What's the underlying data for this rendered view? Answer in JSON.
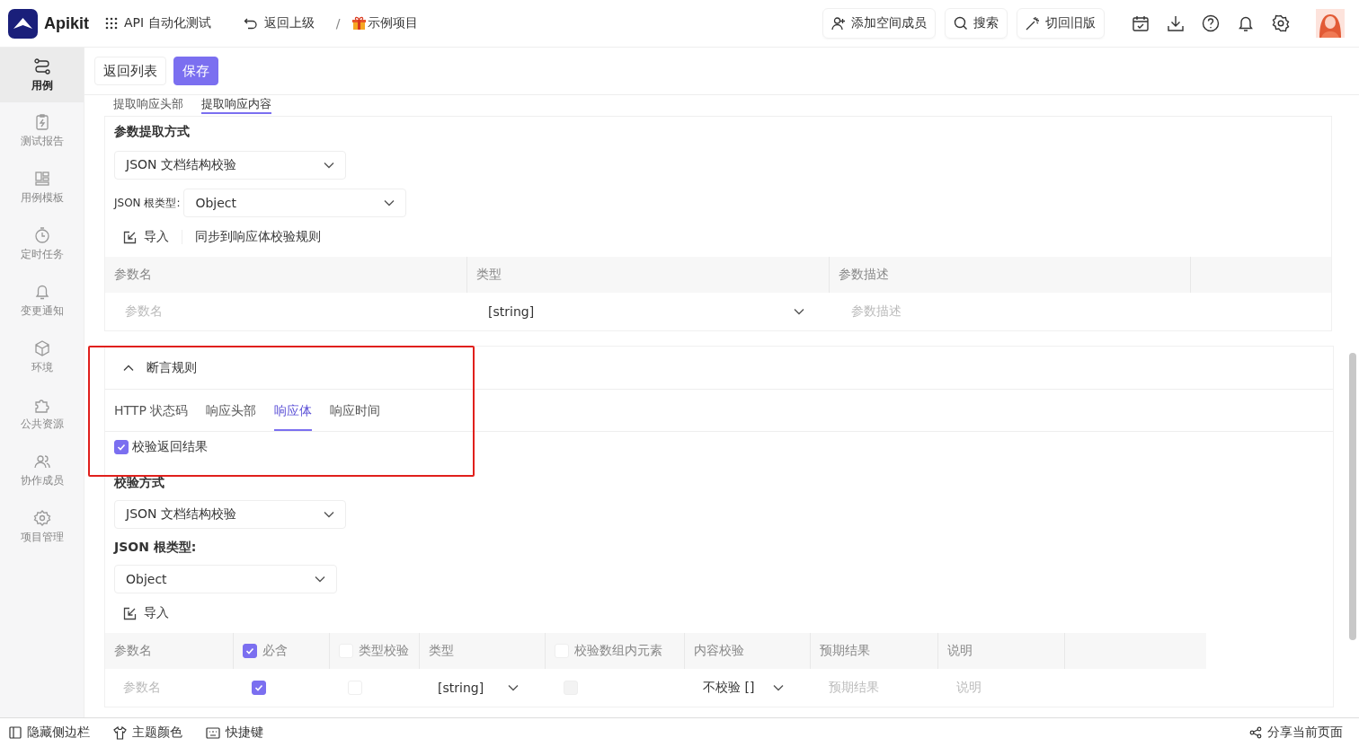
{
  "header": {
    "logo_text": "Apikit",
    "module": "API 自动化测试",
    "back": "返回上级",
    "separator": "/",
    "project": "示例项目",
    "actions": [
      {
        "label": "添加空间成员",
        "kind": "add-user"
      },
      {
        "label": "搜索",
        "kind": "search"
      },
      {
        "label": "切回旧版",
        "kind": "wand"
      }
    ]
  },
  "sidebar": {
    "items": [
      {
        "label": "用例",
        "selected": true,
        "kind": "flow"
      },
      {
        "label": "测试报告",
        "selected": false,
        "kind": "report"
      },
      {
        "label": "用例模板",
        "selected": false,
        "kind": "template"
      },
      {
        "label": "定时任务",
        "selected": false,
        "kind": "timer"
      },
      {
        "label": "变更通知",
        "selected": false,
        "kind": "bell"
      },
      {
        "label": "环境",
        "selected": false,
        "kind": "cube"
      },
      {
        "label": "公共资源",
        "selected": false,
        "kind": "puzzle"
      },
      {
        "label": "协作成员",
        "selected": false,
        "kind": "users"
      },
      {
        "label": "项目管理",
        "selected": false,
        "kind": "gear"
      }
    ]
  },
  "toolbar": {
    "buttons": [
      {
        "label": "返回列表",
        "kind": "default"
      },
      {
        "label": "保存",
        "kind": "primary"
      }
    ]
  },
  "extract": {
    "tabs": [
      {
        "label": "提取响应头部",
        "selected": false
      },
      {
        "label": "提取响应内容",
        "selected": true
      }
    ],
    "method_label": "参数提取方式",
    "method": "JSON 文档结构校验",
    "root_type_label": "JSON 根类型:",
    "root_type": "Object",
    "import": "导入",
    "sync": "同步到响应体校验规则",
    "table": {
      "columns": [
        "参数名",
        "类型",
        "参数描述"
      ],
      "row": {
        "name_placeholder": "参数名",
        "type": "[string]",
        "description_placeholder": "参数描述"
      }
    }
  },
  "assert": {
    "title": "断言规则",
    "expanded": true,
    "tabs": [
      {
        "label": "HTTP 状态码",
        "selected": false
      },
      {
        "label": "响应头部",
        "selected": false
      },
      {
        "label": "响应体",
        "selected": true
      },
      {
        "label": "响应时间",
        "selected": false
      }
    ],
    "verify": {
      "label": "校验返回结果",
      "checked": true
    },
    "method_label": "校验方式",
    "method": "JSON 文档结构校验",
    "root_type_label": "JSON 根类型:",
    "root_type": "Object",
    "import": "导入",
    "table": {
      "columns": [
        {
          "label": "参数名",
          "kind": "text"
        },
        {
          "label": "必含",
          "kind": "check",
          "checked": true
        },
        {
          "label": "类型校验",
          "kind": "check",
          "checked": false
        },
        {
          "label": "类型",
          "kind": "text"
        },
        {
          "label": "校验数组内元素",
          "kind": "check",
          "checked": false
        },
        {
          "label": "内容校验",
          "kind": "text"
        },
        {
          "label": "预期结果",
          "kind": "text"
        },
        {
          "label": "说明",
          "kind": "text"
        }
      ],
      "row": {
        "name_placeholder": "参数名",
        "required": true,
        "type_check": false,
        "type": "[string]",
        "array_check": false,
        "content": "不校验 []",
        "expected_placeholder": "预期结果",
        "note_placeholder": "说明"
      }
    }
  },
  "footer": {
    "items": [
      {
        "label": "隐藏侧边栏",
        "kind": "sidebar"
      },
      {
        "label": "主题颜色",
        "kind": "shirt"
      },
      {
        "label": "快捷键",
        "kind": "keyboard"
      }
    ],
    "share": "分享当前页面"
  }
}
